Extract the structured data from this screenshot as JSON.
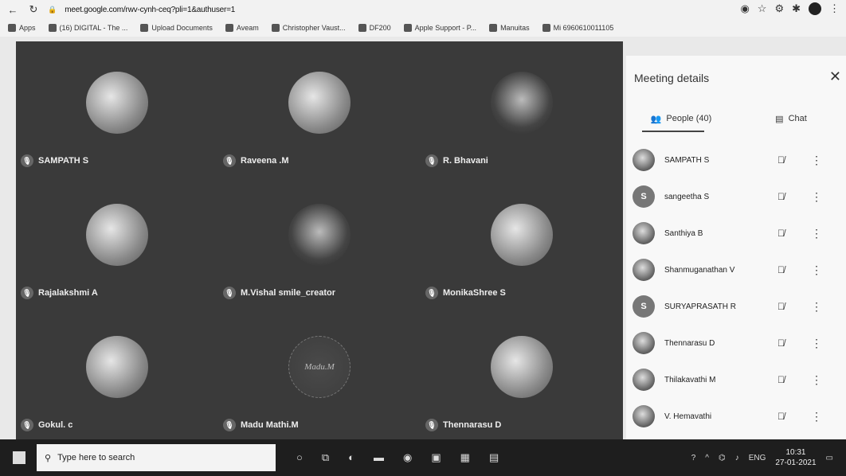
{
  "browser": {
    "url": "meet.google.com/rwv-cynh-ceq?pli=1&authuser=1",
    "bookmarks": [
      "Apps",
      "(16) DIGITAL - The ...",
      "Upload Documents",
      "Aveam",
      "Christopher Vaust...",
      "DF200",
      "Apple Support - P...",
      "Manuitas",
      "Mi 6960610011105"
    ]
  },
  "grid": {
    "tiles": [
      {
        "name": "SAMPATH S"
      },
      {
        "name": "Raveena .M"
      },
      {
        "name": "R. Bhavani"
      },
      {
        "name": "Rajalakshmi A"
      },
      {
        "name": "M.Vishal smile_creator"
      },
      {
        "name": "MonikaShree S"
      },
      {
        "name": "Gokul. c"
      },
      {
        "name": "Madu Mathi.M",
        "avatar_text": "Madu.M"
      },
      {
        "name": "Thennarasu D"
      }
    ]
  },
  "panel": {
    "title": "Meeting details",
    "close": "✕",
    "tab_people": "People (40)",
    "tab_chat": "Chat",
    "people": [
      {
        "name": "SAMPATH S",
        "initial": ""
      },
      {
        "name": "sangeetha S",
        "initial": "S"
      },
      {
        "name": "Santhiya B",
        "initial": ""
      },
      {
        "name": "Shanmuganathan V",
        "initial": ""
      },
      {
        "name": "SURYAPRASATH R",
        "initial": "S"
      },
      {
        "name": "Thennarasu D",
        "initial": ""
      },
      {
        "name": "Thilakavathi M",
        "initial": ""
      },
      {
        "name": "V. Hemavathi",
        "initial": ""
      }
    ]
  },
  "taskbar": {
    "search_placeholder": "Type here to search",
    "lang": "ENG",
    "time": "10:31",
    "date": "27-01-2021"
  }
}
